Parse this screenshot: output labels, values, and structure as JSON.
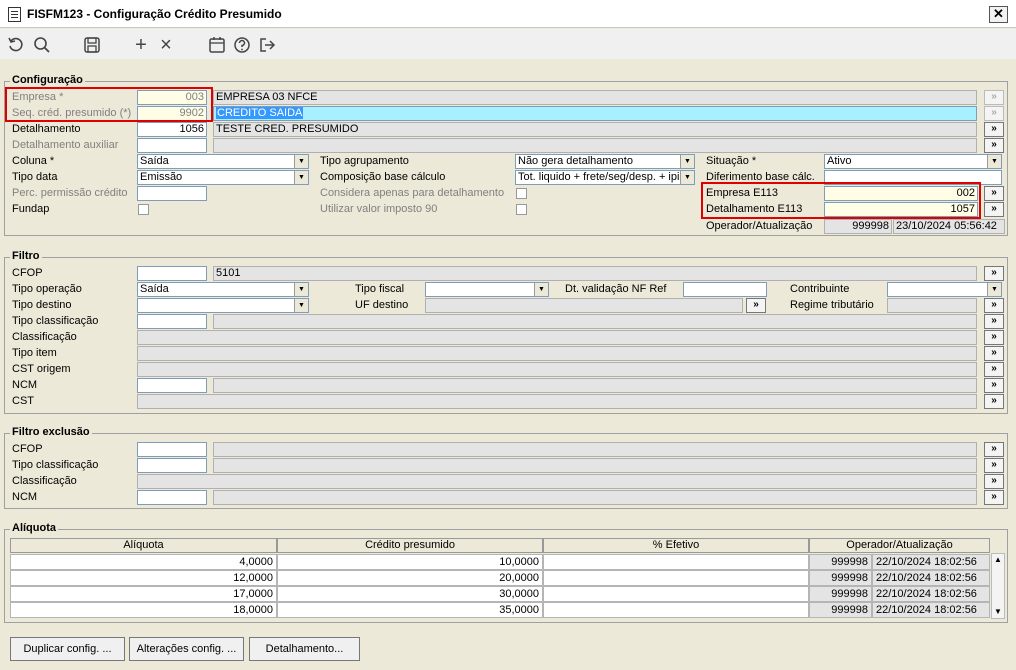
{
  "window": {
    "title": "FISFM123 - Configuração Crédito Presumido",
    "close": "✕"
  },
  "toolbar": {
    "refresh_icon": "refresh-icon",
    "search_icon": "search-icon",
    "save_icon": "save-icon",
    "add": "+",
    "delete": "×"
  },
  "config": {
    "section": "Configuração",
    "empresa_label": "Empresa *",
    "empresa_code": "003",
    "empresa_name": "EMPRESA 03 NFCE",
    "seq_label": "Seq. créd. presumido (*)",
    "seq_code": "9902",
    "seq_name": "CREDITO SAIDA",
    "detalhamento_label": "Detalhamento",
    "detalhamento_code": "1056",
    "detalhamento_name": "TESTE CRED. PRESUMIDO",
    "detalhamento_aux_label": "Detalhamento auxiliar",
    "coluna_label": "Coluna *",
    "coluna_value": "Saída",
    "tipo_data_label": "Tipo data",
    "tipo_data_value": "Emissão",
    "perc_label": "Perc. permissão crédito",
    "fundap_label": "Fundap",
    "tipo_agrup_label": "Tipo agrupamento",
    "tipo_agrup_value": "Não gera detalhamento",
    "comp_base_label": "Composição base cálculo",
    "comp_base_value": "Tot. liquido + frete/seg/desp. + ipi",
    "considera_label": "Considera apenas para detalhamento",
    "utilizar_label": "Utilizar valor imposto 90",
    "situacao_label": "Situação *",
    "situacao_value": "Ativo",
    "diferimento_label": "Diferimento base cálc.",
    "empresa_e113_label": "Empresa E113",
    "empresa_e113_value": "002",
    "detalhamento_e113_label": "Detalhamento E113",
    "detalhamento_e113_value": "1057",
    "operador_label": "Operador/Atualização",
    "operador_value": "999998",
    "operador_date": "23/10/2024 05:56:42"
  },
  "filtro": {
    "section": "Filtro",
    "cfop_label": "CFOP",
    "cfop_value": "5101",
    "tipo_operacao_label": "Tipo operação",
    "tipo_operacao_value": "Saída",
    "tipo_destino_label": "Tipo destino",
    "tipo_class_label": "Tipo classificação",
    "class_label": "Classificação",
    "tipo_item_label": "Tipo item",
    "cst_origem_label": "CST origem",
    "ncm_label": "NCM",
    "cst_label": "CST",
    "tipo_fiscal_label": "Tipo fiscal",
    "uf_destino_label": "UF destino",
    "dt_valid_label": "Dt. validação NF Ref",
    "contribuinte_label": "Contribuinte",
    "regime_label": "Regime tributário"
  },
  "filtro_exclusao": {
    "section": "Filtro exclusão",
    "cfop_label": "CFOP",
    "tipo_class_label": "Tipo classificação",
    "class_label": "Classificação",
    "ncm_label": "NCM"
  },
  "aliquota": {
    "section": "Alíquota",
    "columns": [
      "Alíquota",
      "Crédito presumido",
      "% Efetivo",
      "Operador/Atualização"
    ],
    "rows": [
      {
        "aliquota": "4,0000",
        "credito": "10,0000",
        "efetivo": "",
        "operador": "999998",
        "data": "22/10/2024 18:02:56"
      },
      {
        "aliquota": "12,0000",
        "credito": "20,0000",
        "efetivo": "",
        "operador": "999998",
        "data": "22/10/2024 18:02:56"
      },
      {
        "aliquota": "17,0000",
        "credito": "30,0000",
        "efetivo": "",
        "operador": "999998",
        "data": "22/10/2024 18:02:56"
      },
      {
        "aliquota": "18,0000",
        "credito": "35,0000",
        "efetivo": "",
        "operador": "999998",
        "data": "22/10/2024 18:02:56"
      }
    ]
  },
  "buttons": {
    "duplicar": "Duplicar config. ...",
    "alteracoes": "Alterações config. ...",
    "detalhamento": "Detalhamento..."
  },
  "glyphs": {
    "lookup": "»",
    "arrow": "▼",
    "up": "▲",
    "down": "▼"
  }
}
